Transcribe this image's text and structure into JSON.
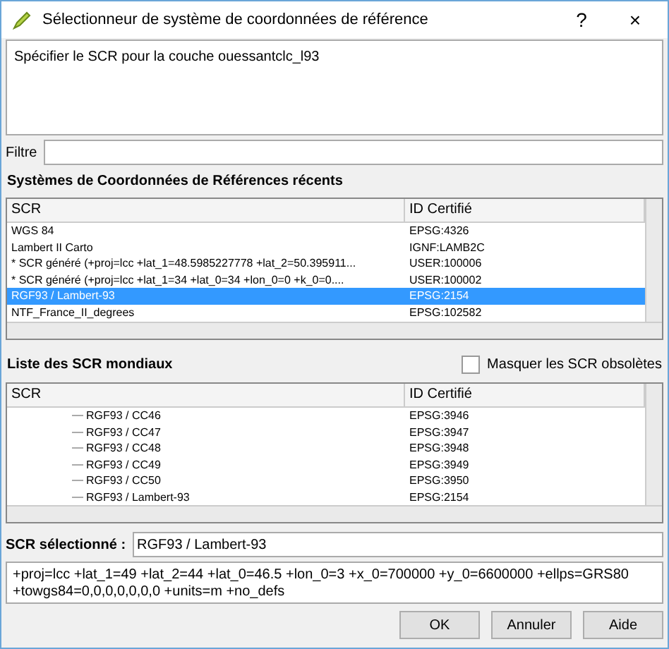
{
  "window": {
    "title": "Sélectionneur de système de coordonnées de référence",
    "help": "?",
    "close": "×"
  },
  "description": "Spécifier le SCR pour la couche ouessantclc_l93",
  "filter": {
    "label": "Filtre"
  },
  "recent": {
    "title": "Systèmes de Coordonnées de Références récents",
    "columns": [
      "SCR",
      "ID Certifié"
    ],
    "rows": [
      {
        "name": "WGS 84",
        "id": "EPSG:4326",
        "selected": false
      },
      {
        "name": "Lambert II Carto",
        "id": "IGNF:LAMB2C",
        "selected": false
      },
      {
        "name": " * SCR généré (+proj=lcc +lat_1=48.5985227778 +lat_2=50.395911...",
        "id": "USER:100006",
        "selected": false
      },
      {
        "name": " * SCR généré (+proj=lcc +lat_1=34 +lat_0=34 +lon_0=0 +k_0=0....",
        "id": "USER:100002",
        "selected": false
      },
      {
        "name": "RGF93 / Lambert-93",
        "id": "EPSG:2154",
        "selected": true
      },
      {
        "name": "NTF_France_II_degrees",
        "id": "EPSG:102582",
        "selected": false
      }
    ]
  },
  "world": {
    "title": "Liste des SCR mondiaux",
    "hide_deprecated": {
      "label": "Masquer les SCR obsolètes",
      "checked": false
    },
    "columns": [
      "SCR",
      "ID Certifié"
    ],
    "rows": [
      {
        "name": "RGF93 / CC46",
        "id": "EPSG:3946"
      },
      {
        "name": "RGF93 / CC47",
        "id": "EPSG:3947"
      },
      {
        "name": "RGF93 / CC48",
        "id": "EPSG:3948"
      },
      {
        "name": "RGF93 / CC49",
        "id": "EPSG:3949"
      },
      {
        "name": "RGF93 / CC50",
        "id": "EPSG:3950"
      },
      {
        "name": "RGF93 / Lambert-93",
        "id": "EPSG:2154"
      }
    ]
  },
  "selected_crs": {
    "label": "SCR sélectionné :",
    "value": "RGF93 / Lambert-93"
  },
  "proj_string": "+proj=lcc +lat_1=49 +lat_2=44 +lat_0=46.5 +lon_0=3 +x_0=700000 +y_0=6600000 +ellps=GRS80 +towgs84=0,0,0,0,0,0,0 +units=m +no_defs",
  "buttons": [
    "OK",
    "Annuler",
    "Aide"
  ]
}
